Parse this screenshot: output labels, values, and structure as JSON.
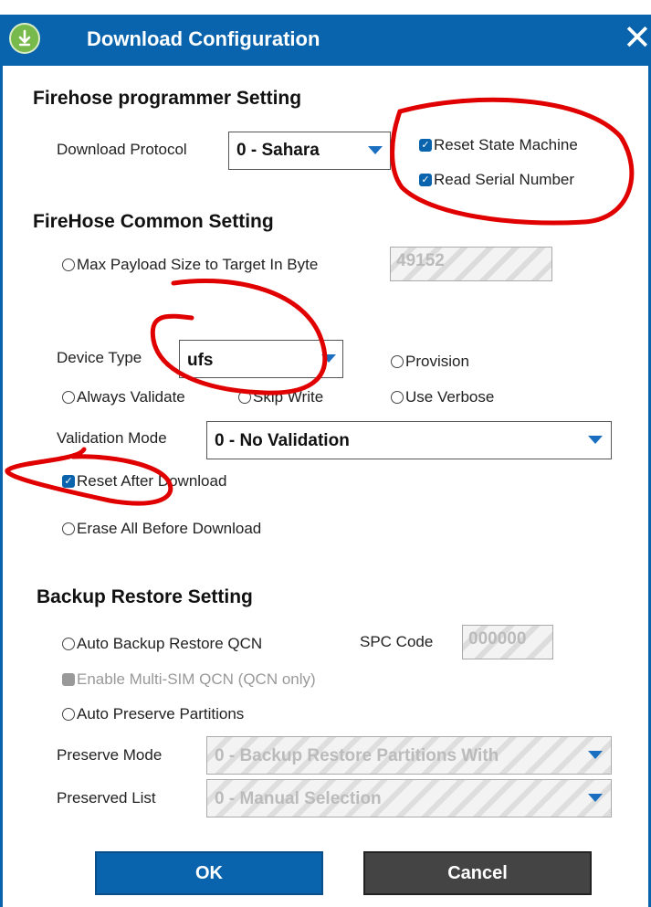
{
  "window": {
    "title": "Download Configuration",
    "close_glyph": "✕",
    "icon": "download-arrow-icon"
  },
  "firehose": {
    "section_title": "Firehose programmer Setting",
    "protocol_label": "Download Protocol",
    "protocol_value": "0 - Sahara",
    "reset_state_machine": "Reset State Machine",
    "read_serial_number": "Read Serial Number"
  },
  "common": {
    "section_title": "FireHose Common Setting",
    "max_payload_label": "Max Payload Size to Target In Byte",
    "max_payload_value": "49152",
    "device_type_label": "Device Type",
    "device_type_value": "ufs",
    "provision": "Provision",
    "always_validate": "Always Validate",
    "skip_write": "Skip Write",
    "use_verbose": "Use Verbose",
    "validation_mode_label": "Validation Mode",
    "validation_mode_value": "0 - No Validation",
    "reset_after_download": "Reset After Download",
    "erase_all": "Erase All Before Download"
  },
  "backup": {
    "section_title": "Backup Restore Setting",
    "auto_backup": "Auto Backup Restore QCN",
    "spc_code_label": "SPC Code",
    "spc_code_value": "000000",
    "enable_multi_sim": "Enable Multi-SIM QCN (QCN only)",
    "auto_preserve": "Auto Preserve Partitions",
    "preserve_mode_label": "Preserve Mode",
    "preserve_mode_value": "0 - Backup Restore Partitions With",
    "preserved_list_label": "Preserved List",
    "preserved_list_value": "0 - Manual Selection"
  },
  "buttons": {
    "ok": "OK",
    "cancel": "Cancel"
  },
  "state": {
    "reset_state_machine": true,
    "read_serial_number": true,
    "max_payload": false,
    "provision": false,
    "always_validate": false,
    "skip_write": false,
    "use_verbose": false,
    "reset_after_download": true,
    "erase_all": false,
    "auto_backup": false,
    "enable_multi_sim": false,
    "auto_preserve": false
  },
  "colors": {
    "accent": "#0a64ad",
    "annotation": "#e00000",
    "cancel_button": "#444444"
  }
}
